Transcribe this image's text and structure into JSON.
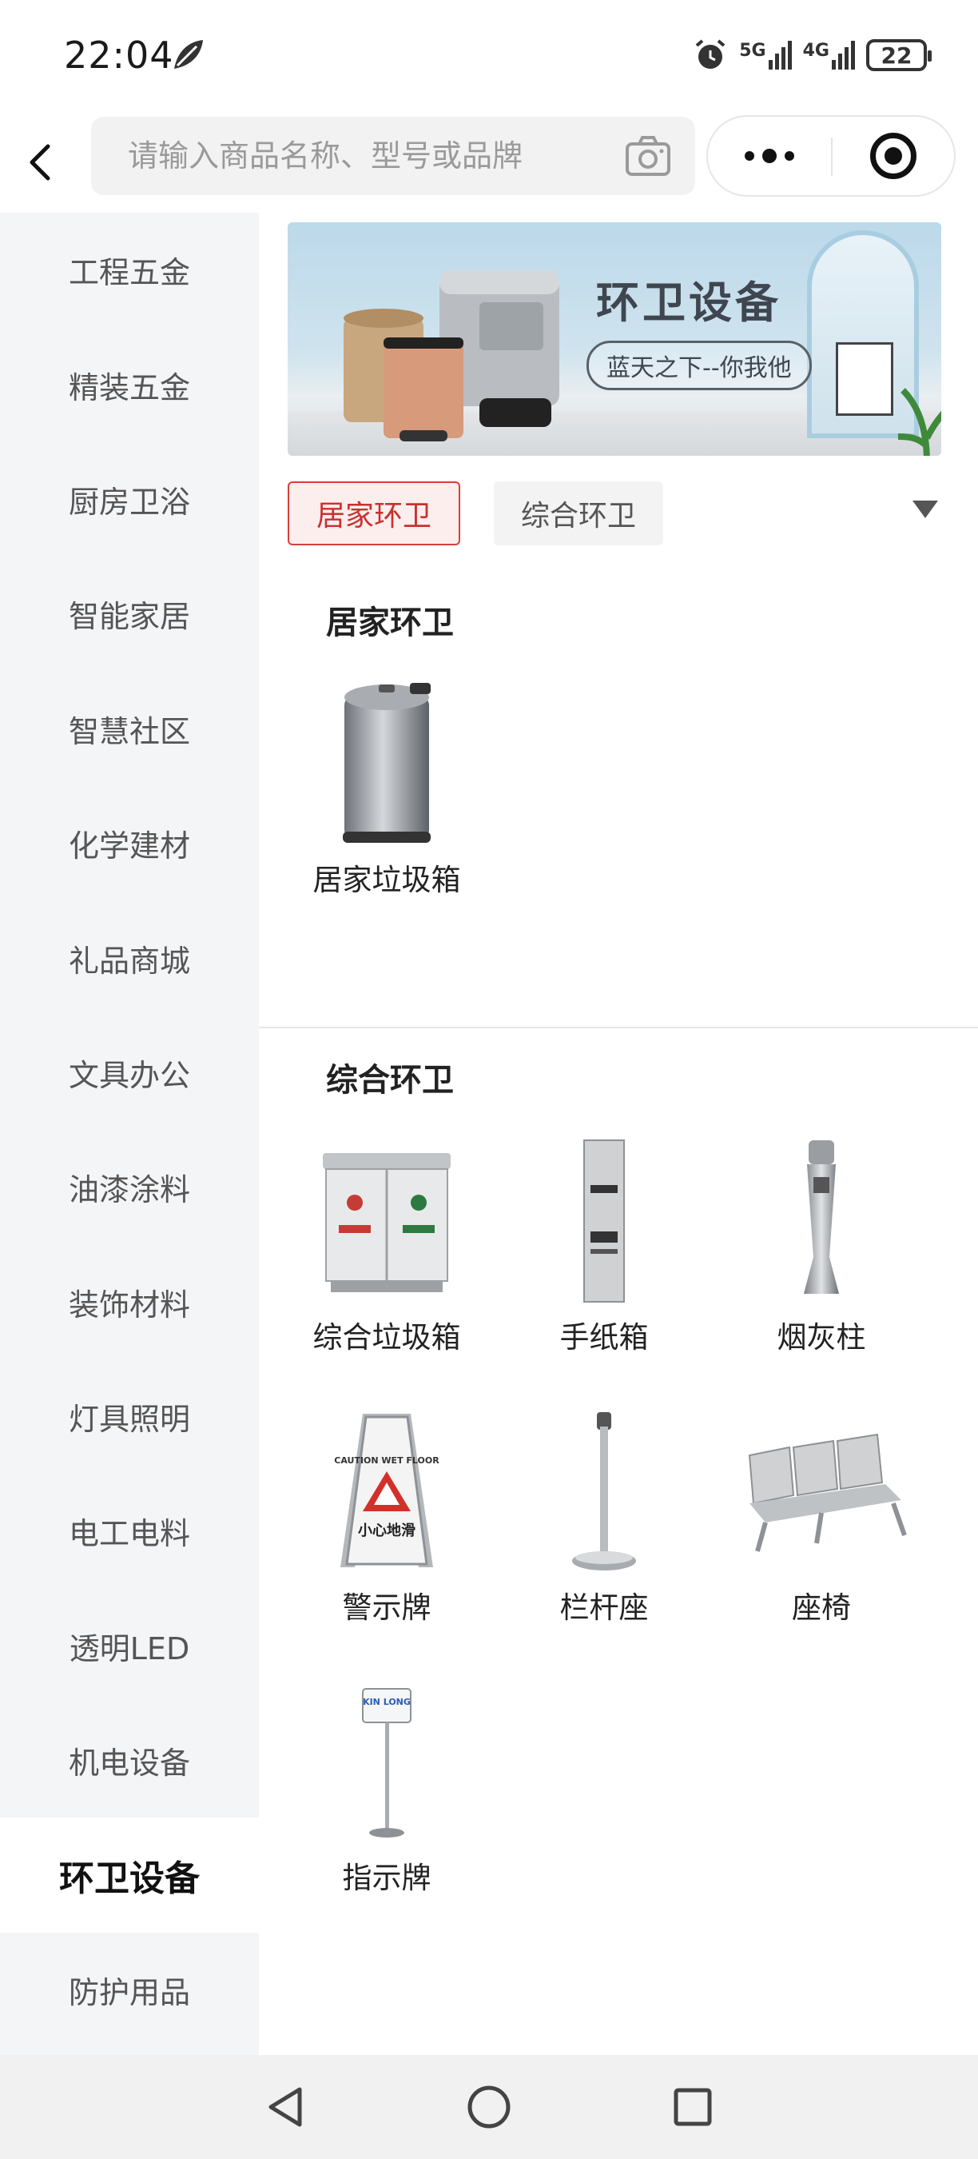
{
  "status_bar": {
    "time": "22:04",
    "signal_5g": "5G",
    "signal_4g": "4G",
    "battery": "22"
  },
  "header": {
    "search_placeholder": "请输入商品名称、型号或品牌"
  },
  "sidebar": {
    "items": [
      {
        "label": "工程五金"
      },
      {
        "label": "精装五金"
      },
      {
        "label": "厨房卫浴"
      },
      {
        "label": "智能家居"
      },
      {
        "label": "智慧社区"
      },
      {
        "label": "化学建材"
      },
      {
        "label": "礼品商城"
      },
      {
        "label": "文具办公"
      },
      {
        "label": "油漆涂料"
      },
      {
        "label": "装饰材料"
      },
      {
        "label": "灯具照明"
      },
      {
        "label": "电工电料"
      },
      {
        "label": "透明LED"
      },
      {
        "label": "机电设备"
      },
      {
        "label": "环卫设备",
        "active": true
      },
      {
        "label": "防护用品"
      }
    ]
  },
  "banner": {
    "title": "环卫设备",
    "subtitle": "蓝天之下--你我他"
  },
  "tabs": [
    {
      "label": "居家环卫",
      "active": true
    },
    {
      "label": "综合环卫",
      "active": false
    }
  ],
  "sections": [
    {
      "title": "居家环卫",
      "products": [
        {
          "name": "居家垃圾箱",
          "icon": "pedal-bin-icon"
        }
      ]
    },
    {
      "title": "综合环卫",
      "products": [
        {
          "name": "综合垃圾箱",
          "icon": "recycle-bin-icon"
        },
        {
          "name": "手纸箱",
          "icon": "paper-dispenser-icon"
        },
        {
          "name": "烟灰柱",
          "icon": "ashtray-column-icon"
        },
        {
          "name": "警示牌",
          "icon": "warning-sign-icon"
        },
        {
          "name": "栏杆座",
          "icon": "stanchion-icon"
        },
        {
          "name": "座椅",
          "icon": "bench-icon"
        },
        {
          "name": "指示牌",
          "icon": "sign-stand-icon"
        }
      ]
    }
  ],
  "product_labels": {
    "caution": "CAUTION WET FLOOR",
    "slippery": "小心地滑",
    "brand": "KIN LONG"
  }
}
